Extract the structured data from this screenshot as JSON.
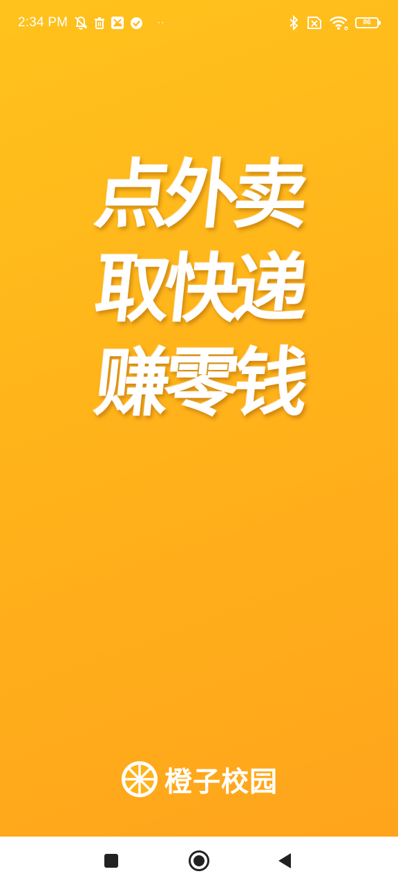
{
  "status_bar": {
    "time": "2:34 PM",
    "more_indicator": "··",
    "battery_level": "86",
    "icons_left": [
      "mute-icon",
      "trash-icon",
      "gallery-icon",
      "check-circle-icon"
    ],
    "icons_right": [
      "bluetooth-icon",
      "sim-off-icon",
      "wifi-icon",
      "battery-icon"
    ]
  },
  "slogan": {
    "lines": [
      "点外卖",
      "取快递",
      "赚零钱"
    ]
  },
  "brand": {
    "name": "橙子校园",
    "logo_icon": "orange-slice-icon"
  },
  "nav": {
    "recents_icon": "square-icon",
    "home_icon": "circle-icon",
    "back_icon": "triangle-back-icon"
  },
  "colors": {
    "background_top": "#FFC21C",
    "background_bottom": "#FFA31C",
    "text": "#FFFFFF",
    "nav_bg": "#FFFFFF",
    "nav_icon": "#222222"
  }
}
